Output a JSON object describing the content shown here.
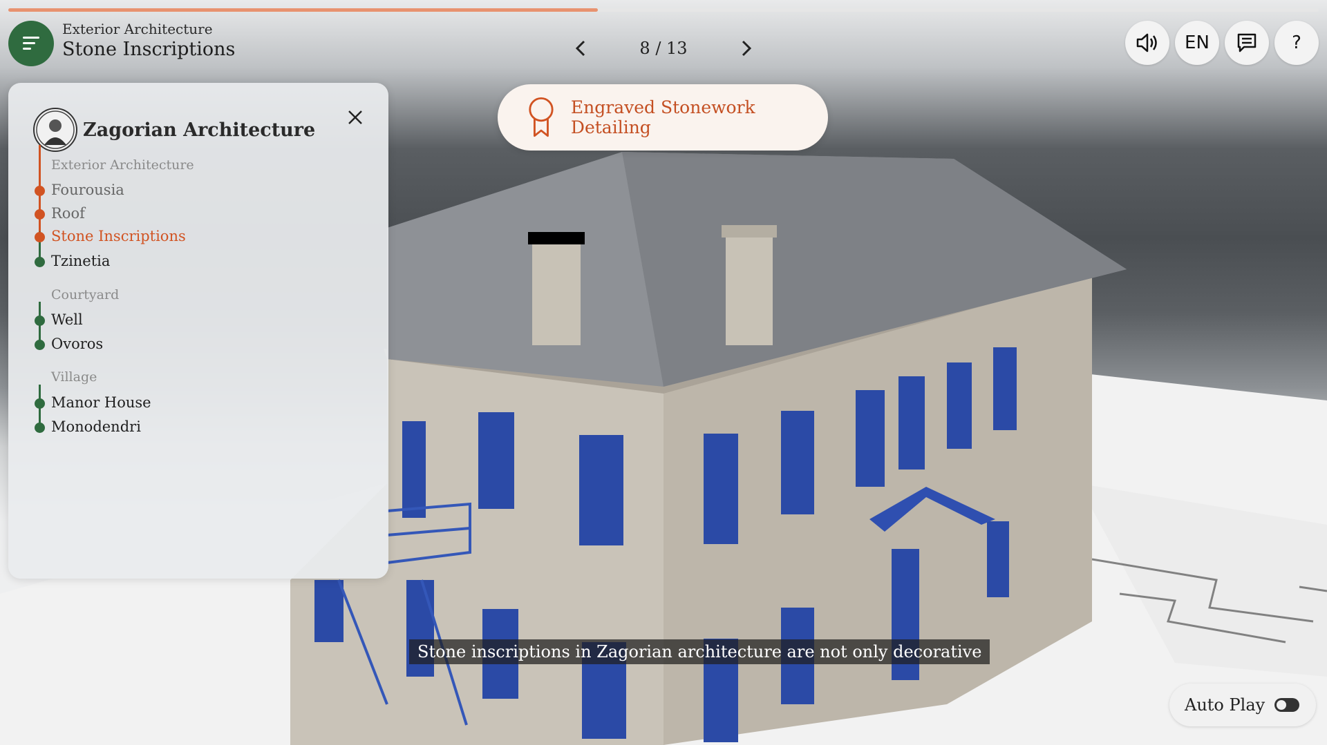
{
  "progress": {
    "fraction": 0.45
  },
  "header": {
    "section": "Exterior Architecture",
    "title": "Stone Inscriptions"
  },
  "pager": {
    "label": "8 / 13"
  },
  "tools": {
    "sound_icon": "speaker-icon",
    "language": "EN",
    "subtitles_icon": "chat-icon",
    "help": "?"
  },
  "badge": {
    "icon": "award-ribbon-icon",
    "label": "Engraved Stonework Detailing"
  },
  "panel": {
    "title": "Zagorian Architecture",
    "groups": [
      {
        "name": "Exterior Architecture",
        "items": [
          {
            "label": "Fourousia",
            "state": "done"
          },
          {
            "label": "Roof",
            "state": "done"
          },
          {
            "label": "Stone Inscriptions",
            "state": "active"
          },
          {
            "label": "Tzinetia",
            "state": "todo"
          }
        ]
      },
      {
        "name": "Courtyard",
        "items": [
          {
            "label": "Well",
            "state": "todo"
          },
          {
            "label": "Ovoros",
            "state": "todo"
          }
        ]
      },
      {
        "name": "Village",
        "items": [
          {
            "label": "Manor House",
            "state": "todo"
          },
          {
            "label": "Monodendri",
            "state": "todo"
          }
        ]
      }
    ]
  },
  "caption": "Stone inscriptions in Zagorian architecture are not only decorative",
  "autoplay": {
    "label": "Auto Play",
    "on": false
  },
  "colors": {
    "accent": "#d15322",
    "done_dot": "#d15322",
    "todo_dot": "#2f6b3f",
    "menu": "#2f6b3f"
  }
}
